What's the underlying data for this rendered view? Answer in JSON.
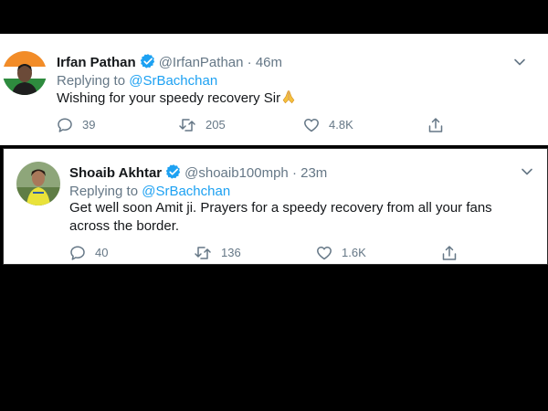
{
  "tweets": [
    {
      "name": "Irfan Pathan",
      "handle": "@IrfanPathan",
      "separator": "·",
      "time": "46m",
      "replying_prefix": "Replying to",
      "replying_to": "@SrBachchan",
      "text": "Wishing for your speedy recovery Sir",
      "emoji": "folded-hands",
      "replies": "39",
      "retweets": "205",
      "likes": "4.8K"
    },
    {
      "name": "Shoaib Akhtar",
      "handle": "@shoaib100mph",
      "separator": "·",
      "time": "23m",
      "replying_prefix": "Replying to",
      "replying_to": "@SrBachchan",
      "text": "Get well soon Amit ji. Prayers for a speedy recovery from all your fans across the border.",
      "replies": "40",
      "retweets": "136",
      "likes": "1.6K"
    }
  ],
  "colors": {
    "accent": "#1da1f2",
    "text": "#14171a",
    "secondary": "#657786",
    "background": "#000000"
  }
}
